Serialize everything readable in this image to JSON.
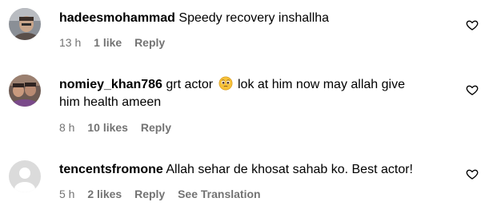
{
  "comments": [
    {
      "username": "hadeesmohammad",
      "text_line1": "Speedy recovery inshallha",
      "time": "13 h",
      "likes": "1 like",
      "reply": "Reply"
    },
    {
      "username": "nomiey_khan786",
      "text_before_emoji": "grt actor",
      "emoji": "pleading-face-emoji",
      "text_after_emoji": "lok at him now may allah give",
      "text_line2": "him health ameen",
      "time": "8 h",
      "likes": "10 likes",
      "reply": "Reply"
    },
    {
      "username": "tencentsfromone",
      "text_line1": "Allah sehar de khosat sahab ko. Best actor!",
      "time": "5 h",
      "likes": "2 likes",
      "reply": "Reply",
      "translation": "See Translation"
    }
  ],
  "icons": {
    "like": "heart-outline-icon",
    "default_avatar": "default-avatar-icon"
  },
  "colors": {
    "meta_text": "#737373",
    "default_avatar_bg": "#dbdbdb",
    "default_avatar_fg": "#ffffff"
  }
}
